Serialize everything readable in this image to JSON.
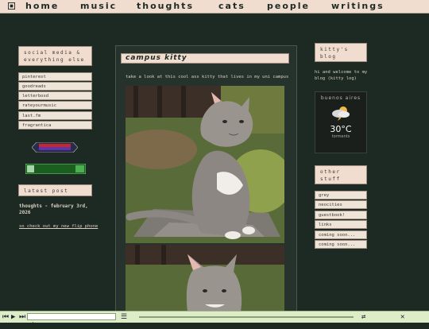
{
  "nav": {
    "items": [
      {
        "label": "home"
      },
      {
        "label": "music"
      },
      {
        "label": "thoughts"
      },
      {
        "label": "cats"
      },
      {
        "label": "people"
      },
      {
        "label": "writings"
      }
    ]
  },
  "left_sidebar": {
    "header_title": "social media & everything else",
    "links": [
      {
        "label": "pinterest"
      },
      {
        "label": "goodreads"
      },
      {
        "label": "letterboxd"
      },
      {
        "label": "rateyourmusic"
      },
      {
        "label": "last.fm"
      },
      {
        "label": "fragrantica"
      }
    ],
    "badge1_text": "",
    "badge2_text": "",
    "latest_post_title": "latest post",
    "latest_post_heading": "thoughts - february 3rd, 2026",
    "latest_post_link": "so check out my new flip phone"
  },
  "main": {
    "post_title": "campus kitty",
    "post_text": "take a look at this cool ass kitty that lives in my uni campus"
  },
  "right_sidebar": {
    "welcome_title": "kitty's blog",
    "welcome_text": "hi and welcome to my blog (kitty log)",
    "weather": {
      "city": "buenos aires",
      "temp": "30°C",
      "condition": "torments"
    },
    "pages_title": "other stuff",
    "links": [
      {
        "label": "grey"
      },
      {
        "label": "neocities"
      },
      {
        "label": "guestbook!"
      },
      {
        "label": "links"
      },
      {
        "label": "coming soon..."
      },
      {
        "label": "coming soon..."
      }
    ]
  },
  "player": {
    "track": "ok"
  },
  "colors": {
    "background": "#1d2a23",
    "accent": "#f0ddd0",
    "player": "#dcedc8"
  }
}
